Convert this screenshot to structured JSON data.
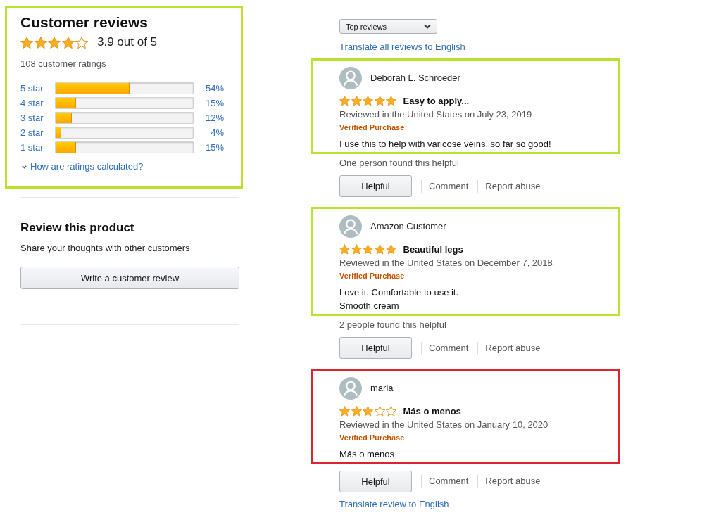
{
  "summary": {
    "title": "Customer reviews",
    "color": "#b9e32b",
    "stars": 4,
    "rating": "3.9 out of 5",
    "total_ratings": "108 customer ratings",
    "histogram": [
      {
        "label": "5 star",
        "level": 0.54,
        "percent": "54%"
      },
      {
        "label": "4 star",
        "level": 0.15,
        "percent": "15%"
      },
      {
        "label": "3 star",
        "level": 0.12,
        "percent": "12%"
      },
      {
        "label": "2 star",
        "level": 0.04,
        "percent": "4%"
      },
      {
        "label": "1 star",
        "level": 0.15,
        "percent": "15%"
      }
    ],
    "ratings_link": "How are ratings calculated?"
  },
  "write_review": {
    "title": "Review this product",
    "subtitle": "Share your thoughts with other customers",
    "button": "Write a customer review"
  },
  "sort": {
    "value": "Top reviews"
  },
  "translate_all": "Translate all reviews to English",
  "reviews": [
    {
      "color": "#b9e32b",
      "author": "Deborah L. Schroeder",
      "stars": 5,
      "title": "Easy to apply...",
      "date": "Reviewed in the United States on July 23, 2019",
      "badge": "Verified Purchase",
      "body": [
        "I use this to help with varicose veins, so far so good!"
      ],
      "helpful_count": "One person found this helpful",
      "actions": [
        {
          "kind": "button",
          "label": "Helpful"
        },
        {
          "kind": "link",
          "label": "Comment"
        },
        {
          "kind": "link",
          "label": "Report abuse"
        }
      ]
    },
    {
      "color": "#b9e32b",
      "author": "Amazon Customer",
      "stars": 5,
      "title": "Beautiful legs",
      "date": "Reviewed in the United States on December 7, 2018",
      "badge": "Verified Purchase",
      "body": [
        "Love it. Comfortable to use it.",
        "Smooth cream"
      ],
      "helpful_count": "2 people found this helpful",
      "actions": [
        {
          "kind": "button",
          "label": "Helpful"
        },
        {
          "kind": "link",
          "label": "Comment"
        },
        {
          "kind": "link",
          "label": "Report abuse"
        }
      ]
    },
    {
      "color": "#dc2430",
      "author": "maria",
      "stars": 3,
      "title": "Más o menos",
      "date": "Reviewed in the United States on January 10, 2020",
      "badge": "Verified Purchase",
      "body": [
        "Más o menos"
      ],
      "actions": [
        {
          "kind": "button",
          "label": "Helpful"
        },
        {
          "kind": "link",
          "label": "Comment"
        },
        {
          "kind": "link",
          "label": "Report abuse"
        }
      ],
      "translate": "Translate review to English"
    }
  ]
}
